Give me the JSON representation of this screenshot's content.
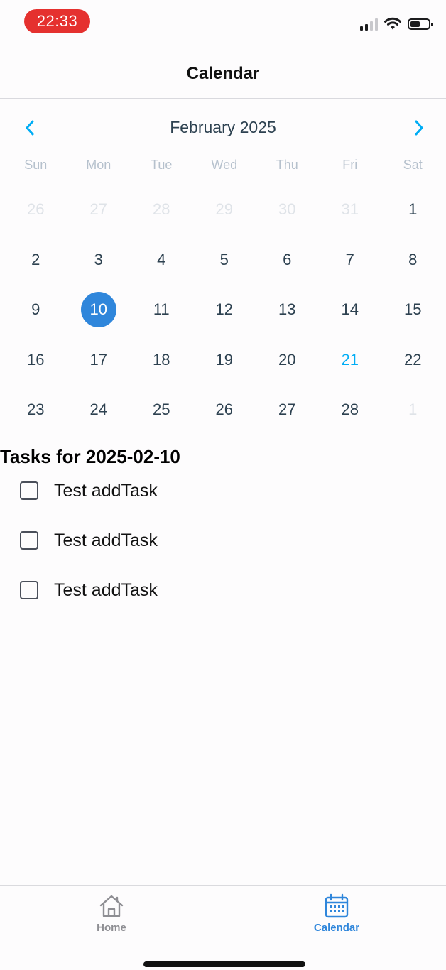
{
  "status_bar": {
    "time": "22:33"
  },
  "header": {
    "title": "Calendar"
  },
  "calendar": {
    "month_label": "February 2025",
    "weekdays": [
      "Sun",
      "Mon",
      "Tue",
      "Wed",
      "Thu",
      "Fri",
      "Sat"
    ],
    "days": [
      {
        "label": "26",
        "state": "outside"
      },
      {
        "label": "27",
        "state": "outside"
      },
      {
        "label": "28",
        "state": "outside"
      },
      {
        "label": "29",
        "state": "outside"
      },
      {
        "label": "30",
        "state": "outside"
      },
      {
        "label": "31",
        "state": "outside"
      },
      {
        "label": "1",
        "state": "normal"
      },
      {
        "label": "2",
        "state": "normal"
      },
      {
        "label": "3",
        "state": "normal"
      },
      {
        "label": "4",
        "state": "normal"
      },
      {
        "label": "5",
        "state": "normal"
      },
      {
        "label": "6",
        "state": "normal"
      },
      {
        "label": "7",
        "state": "normal"
      },
      {
        "label": "8",
        "state": "normal"
      },
      {
        "label": "9",
        "state": "normal"
      },
      {
        "label": "10",
        "state": "selected"
      },
      {
        "label": "11",
        "state": "normal"
      },
      {
        "label": "12",
        "state": "normal"
      },
      {
        "label": "13",
        "state": "normal"
      },
      {
        "label": "14",
        "state": "normal"
      },
      {
        "label": "15",
        "state": "normal"
      },
      {
        "label": "16",
        "state": "normal"
      },
      {
        "label": "17",
        "state": "normal"
      },
      {
        "label": "18",
        "state": "normal"
      },
      {
        "label": "19",
        "state": "normal"
      },
      {
        "label": "20",
        "state": "normal"
      },
      {
        "label": "21",
        "state": "today"
      },
      {
        "label": "22",
        "state": "normal"
      },
      {
        "label": "23",
        "state": "normal"
      },
      {
        "label": "24",
        "state": "normal"
      },
      {
        "label": "25",
        "state": "normal"
      },
      {
        "label": "26",
        "state": "normal"
      },
      {
        "label": "27",
        "state": "normal"
      },
      {
        "label": "28",
        "state": "normal"
      },
      {
        "label": "1",
        "state": "outside"
      }
    ],
    "colors": {
      "selected": "#2f86db",
      "today": "#00adf5",
      "arrow": "#00adf5"
    }
  },
  "tasks": {
    "title": "Tasks for 2025-02-10",
    "items": [
      {
        "label": "Test addTask",
        "checked": false
      },
      {
        "label": "Test addTask",
        "checked": false
      },
      {
        "label": "Test addTask",
        "checked": false
      }
    ]
  },
  "tab_bar": {
    "home_label": "Home",
    "calendar_label": "Calendar",
    "active": "calendar",
    "home_icon": "home-icon",
    "calendar_icon": "calendar-icon"
  }
}
